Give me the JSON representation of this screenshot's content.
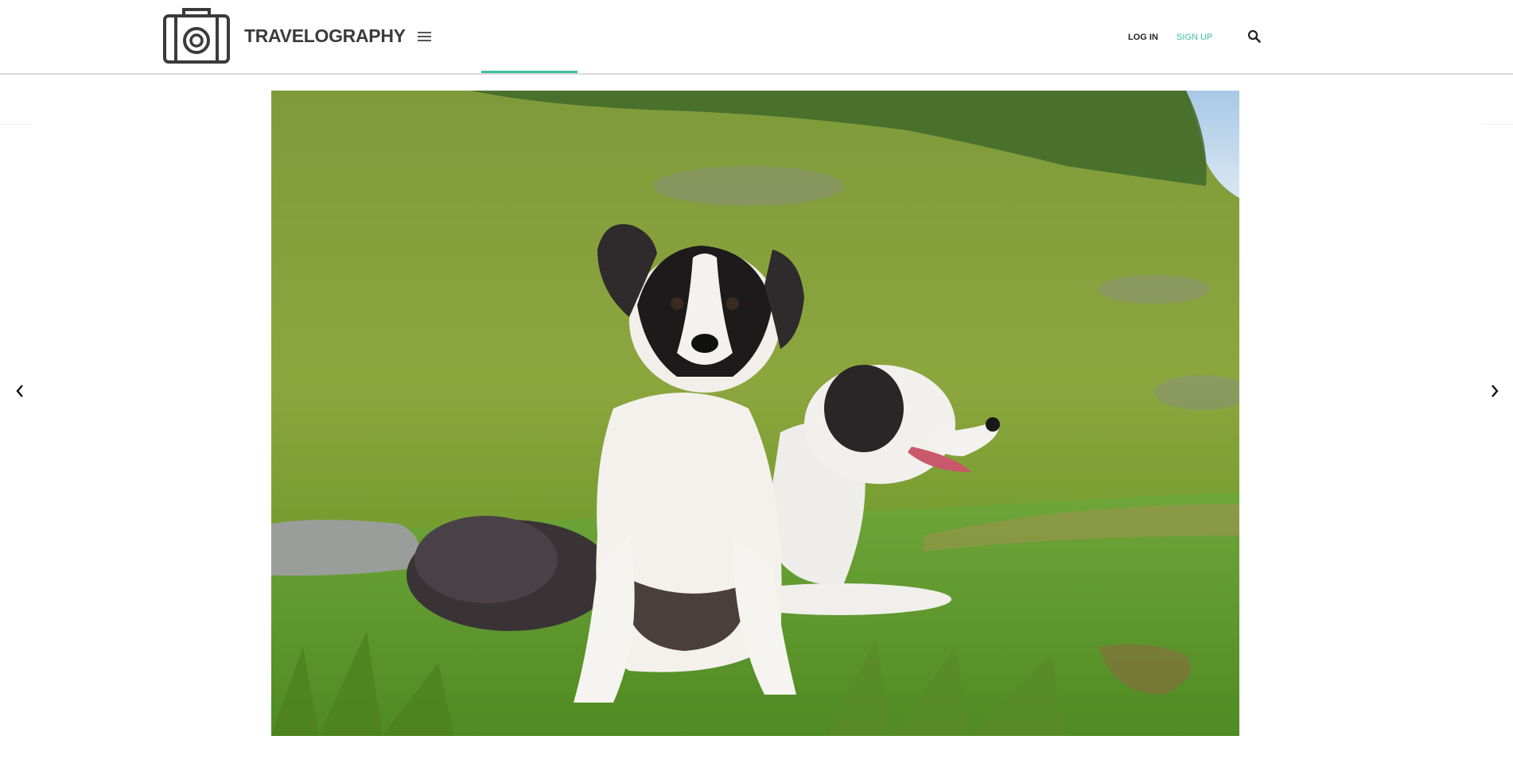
{
  "header": {
    "brand": "TRAVELOGRAPHY",
    "login_label": "LOG IN",
    "signup_label": "SIGN UP"
  },
  "icons": {
    "logo": "camera-icon",
    "menu": "hamburger-menu-icon",
    "search": "search-icon",
    "prev": "chevron-left-icon",
    "next": "chevron-right-icon"
  },
  "colors": {
    "accent": "#3cbf9b",
    "brand_text": "#3b3b3b"
  },
  "photo": {
    "subject": "two dogs on a grassy mountain slope"
  }
}
